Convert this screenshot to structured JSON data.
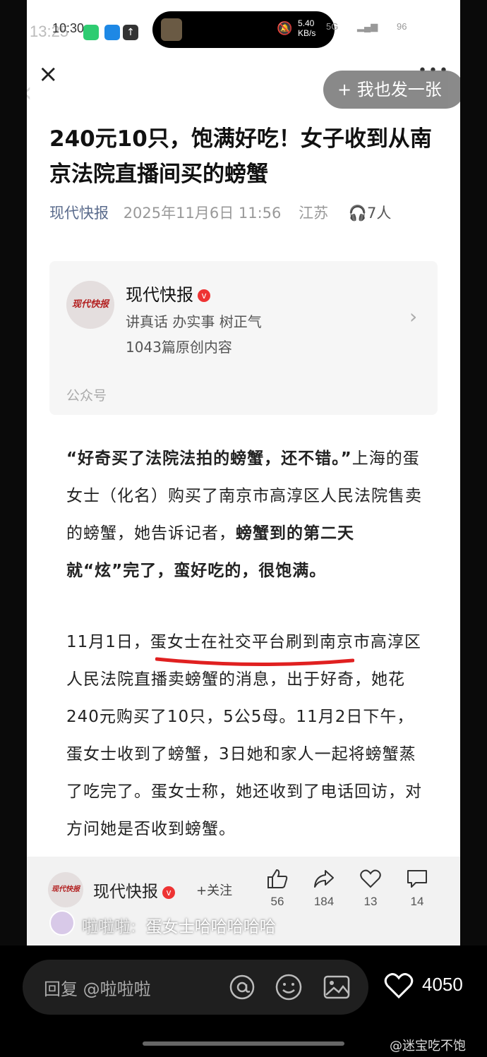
{
  "status_bar": {
    "time_ghost": "13:25",
    "time": "10:30",
    "speed": "5.40\nKB/s",
    "signal_text": "5G",
    "battery": "96"
  },
  "nav": {
    "post_button": "+ 我也发一张"
  },
  "article": {
    "title": "240元10只，饱满好吃！女子收到从南京法院直播间买的螃蟹",
    "source": "现代快报",
    "date": "2025年11月6日 11:56",
    "location": "江苏",
    "readers": "7人"
  },
  "account_card": {
    "logo_text": "现代快报",
    "name": "现代快报",
    "slogan": "讲真话 办实事 树正气",
    "count": "1043篇原创内容",
    "type": "公众号"
  },
  "body": {
    "p1_bold_quote": "“好奇买了法院法拍的螃蟹，还不错。”",
    "p1_text": "上海的蛋女士（化名）购买了南京市高淳区人民法院售卖的螃蟹，她告诉记者，",
    "p1_bold_end": "螃蟹到的第二天就“炫”完了，蛮好吃的，很饱满。",
    "p2": "11月1日，蛋女士在社交平台刷到南京市高淳区人民法院直播卖螃蟹的消息，出于好奇，她花240元购买了10只，5公5母。11月2日下午，蛋女士收到了螃蟹，3日她和家人一起将螃蟹蒸了吃完了。蛋女士称，她还收到了电话回访，对方问她是否收到螃蟹。"
  },
  "bottom_bar": {
    "logo_text": "现代快报",
    "name": "现代快报",
    "follow": "+关注",
    "actions": [
      {
        "icon": "thumbs-up-icon",
        "count": "56"
      },
      {
        "icon": "share-icon",
        "count": "184"
      },
      {
        "icon": "heart-icon",
        "count": "13"
      },
      {
        "icon": "comment-icon",
        "count": "14"
      }
    ]
  },
  "comment": {
    "user": "啦啦啦:",
    "text": "蛋女士哈哈哈哈哈"
  },
  "reply": {
    "placeholder": "回复 @啦啦啦",
    "likes": "4050"
  },
  "watermark": "@迷宝吃不饱",
  "colors": {
    "accent_red": "#e02020",
    "source_blue": "#5a6b8c"
  }
}
